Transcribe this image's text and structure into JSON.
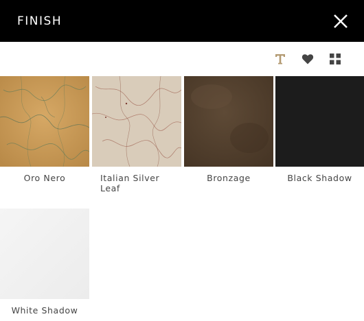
{
  "header": {
    "title": "FINISH"
  },
  "toolbar": {
    "icons": [
      "text-icon",
      "heart-icon",
      "grid-icon"
    ],
    "accent_color": "#b39a72",
    "icon_color": "#444444"
  },
  "finishes": [
    {
      "label": "Oro Nero",
      "color": "#c89a56"
    },
    {
      "label": "Italian Silver Leaf",
      "color": "#d8cbb9"
    },
    {
      "label": "Bronzage",
      "color": "#52402e"
    },
    {
      "label": "Black Shadow",
      "color": "#1c1c1c"
    },
    {
      "label": "White Shadow",
      "color": "#f2f2f2"
    }
  ]
}
